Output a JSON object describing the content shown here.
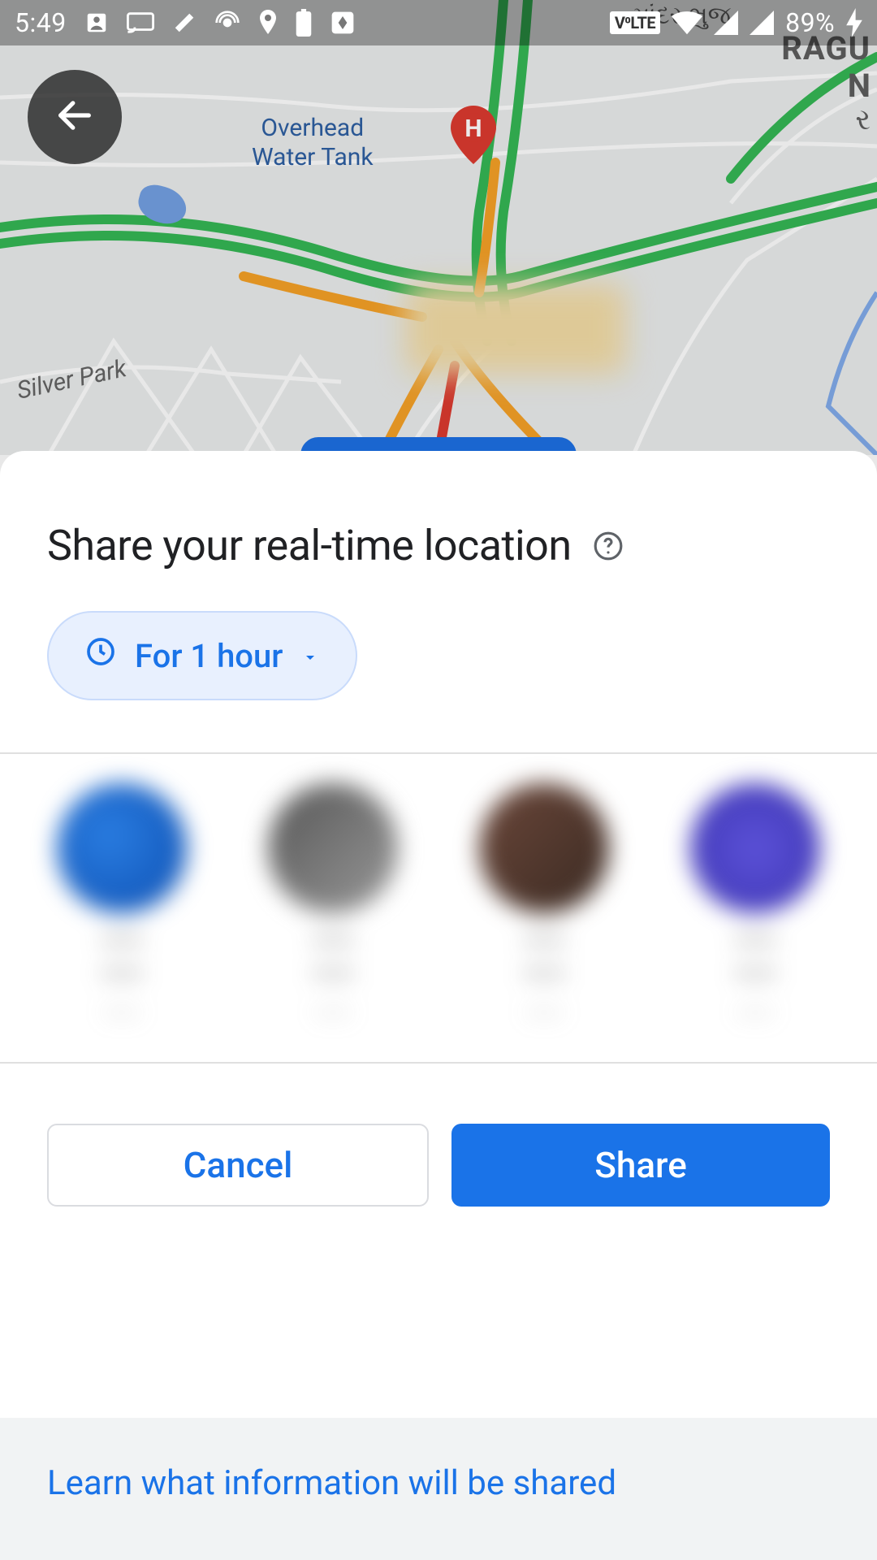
{
  "status_bar": {
    "time": "5:49",
    "volte": "V⁰LTE",
    "battery_text": "89%"
  },
  "map": {
    "poi_line1": "Overhead",
    "poi_line2": "Water Tank",
    "area_label": "Silver Park",
    "pin_letter": "H",
    "edge_text_1": "માંદર ભુજ",
    "edge_text_2": "RAGU",
    "edge_text_3": "N",
    "edge_text_4": "ર"
  },
  "sheet": {
    "title": "Share your real-time location",
    "duration_label": "For 1 hour",
    "cancel_label": "Cancel",
    "share_label": "Share",
    "footer_link": "Learn what information will be shared"
  },
  "contacts": [
    {
      "name_line1": "——",
      "name_line2": "——",
      "sub": "——"
    },
    {
      "name_line1": "——",
      "name_line2": "——",
      "sub": "——"
    },
    {
      "name_line1": "——",
      "name_line2": "——",
      "sub": "——"
    },
    {
      "name_line1": "——",
      "name_line2": "——",
      "sub": "——"
    }
  ]
}
